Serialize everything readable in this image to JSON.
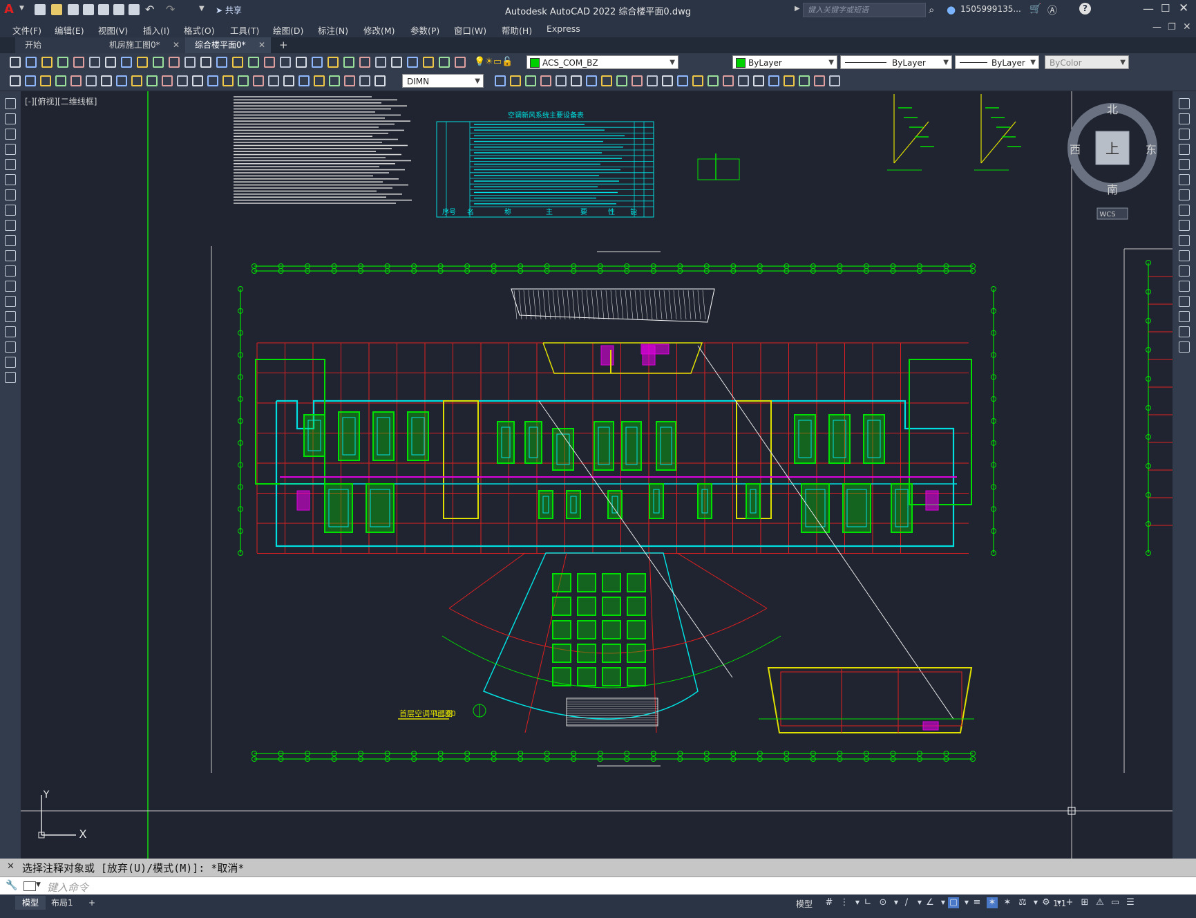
{
  "app": {
    "title": "Autodesk AutoCAD 2022    综合楼平面0.dwg",
    "share_label": "共享",
    "search_placeholder": "键入关键字或短语",
    "user": "1505999135...",
    "window_controls": [
      "minimize-icon",
      "maximize-icon",
      "close-icon"
    ]
  },
  "menu": {
    "items": [
      "文件(F)",
      "编辑(E)",
      "视图(V)",
      "插入(I)",
      "格式(O)",
      "工具(T)",
      "绘图(D)",
      "标注(N)",
      "修改(M)",
      "参数(P)",
      "窗口(W)",
      "帮助(H)",
      "Express"
    ]
  },
  "tabs": [
    {
      "label": "开始",
      "closable": false,
      "active": false
    },
    {
      "label": "机房施工图0*",
      "closable": true,
      "active": false
    },
    {
      "label": "综合楼平面0*",
      "closable": true,
      "active": true
    }
  ],
  "toolbar": {
    "layer": "ACS_COM_BZ",
    "color": "ByLayer",
    "linetype": "ByLayer",
    "lineweight": "ByLayer",
    "plotstyle": "ByColor",
    "dimstyle": "DIMN",
    "layer_color": "#00d000"
  },
  "viewport": {
    "label": "[-][俯视][二维线框]",
    "viewcube": {
      "north": "北",
      "south": "南",
      "east": "东",
      "west": "西",
      "top": "上",
      "wcs": "WCS"
    },
    "ucs": {
      "x": "X",
      "y": "Y"
    }
  },
  "drawing": {
    "table_title": "空调新风系统主要设备表",
    "table_footer": [
      "序号",
      "名",
      "称",
      "主",
      "要",
      "性",
      "能"
    ],
    "plan_title": "首层空调平面图",
    "plan_scale": "1:100"
  },
  "command": {
    "history": "选择注释对象或 [放弃(U)/模式(M)]: *取消*",
    "placeholder": "键入命令"
  },
  "status": {
    "tabs": [
      "模型",
      "布局1"
    ],
    "add_tab": "+",
    "model_label": "模型",
    "scale": "1:1"
  },
  "colors": {
    "background": "#1f2430",
    "grid_red": "#e02020",
    "wall_green": "#00e000",
    "cyan": "#00e0e0",
    "yellow": "#e0e000",
    "magenta": "#e000e0"
  }
}
